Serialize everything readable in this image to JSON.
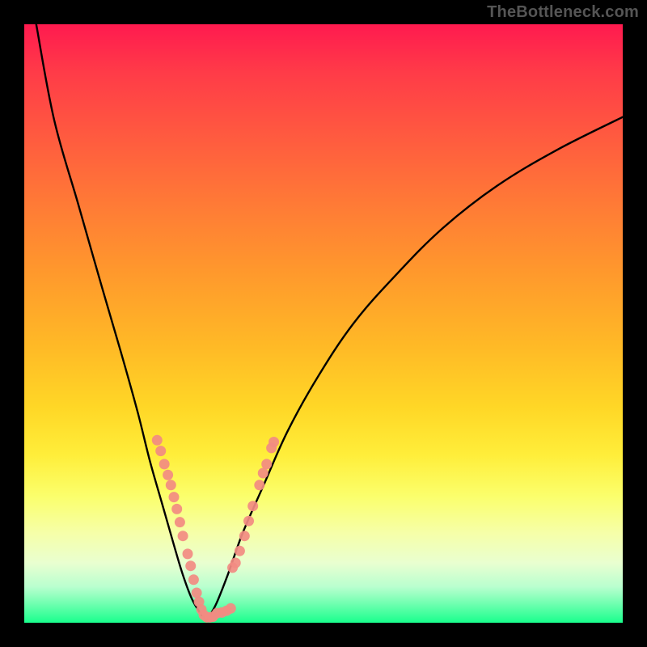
{
  "watermark": "TheBottleneck.com",
  "chart_data": {
    "type": "line",
    "title": "",
    "xlabel": "",
    "ylabel": "",
    "xlim": [
      0,
      100
    ],
    "ylim": [
      0,
      100
    ],
    "grid": false,
    "series": [
      {
        "name": "left-branch",
        "x": [
          2,
          5,
          9,
          13,
          16.5,
          19,
          21,
          23,
          25,
          26.5,
          28,
          29.5,
          30.5
        ],
        "values": [
          100,
          84,
          70,
          56,
          44,
          35,
          27,
          20,
          13,
          8,
          4,
          1.5,
          0.5
        ]
      },
      {
        "name": "right-branch",
        "x": [
          30.5,
          32,
          34,
          36.5,
          40,
          44,
          49,
          55,
          62,
          70,
          79,
          89,
          100
        ],
        "values": [
          0.5,
          3,
          8,
          15,
          23,
          32,
          41,
          50,
          58,
          66,
          73,
          79,
          84.5
        ]
      }
    ],
    "annotations": [
      {
        "name": "scatter-cluster",
        "type": "overlay-points",
        "points": [
          [
            22.2,
            30.5
          ],
          [
            22.8,
            28.7
          ],
          [
            23.4,
            26.5
          ],
          [
            24.0,
            24.7
          ],
          [
            24.5,
            23.0
          ],
          [
            25.0,
            21.0
          ],
          [
            25.5,
            19.0
          ],
          [
            26.0,
            16.8
          ],
          [
            26.5,
            14.5
          ],
          [
            27.3,
            11.5
          ],
          [
            27.8,
            9.5
          ],
          [
            28.3,
            7.2
          ],
          [
            28.8,
            5.0
          ],
          [
            29.2,
            3.5
          ],
          [
            29.6,
            2.2
          ],
          [
            30.0,
            1.3
          ],
          [
            30.5,
            0.9
          ],
          [
            31.0,
            0.9
          ],
          [
            31.5,
            1.0
          ],
          [
            32.2,
            1.6
          ],
          [
            33.0,
            1.7
          ],
          [
            33.8,
            2.0
          ],
          [
            34.5,
            2.4
          ],
          [
            34.8,
            9.2
          ],
          [
            35.3,
            10.0
          ],
          [
            36.0,
            12.0
          ],
          [
            36.8,
            14.5
          ],
          [
            37.5,
            17.0
          ],
          [
            38.2,
            19.5
          ],
          [
            39.3,
            23.0
          ],
          [
            39.9,
            25.0
          ],
          [
            40.5,
            26.5
          ],
          [
            41.3,
            29.2
          ],
          [
            41.7,
            30.2
          ]
        ]
      }
    ]
  },
  "colors": {
    "curve": "#000000",
    "scatter": "#f28b82",
    "watermark": "#555555"
  }
}
